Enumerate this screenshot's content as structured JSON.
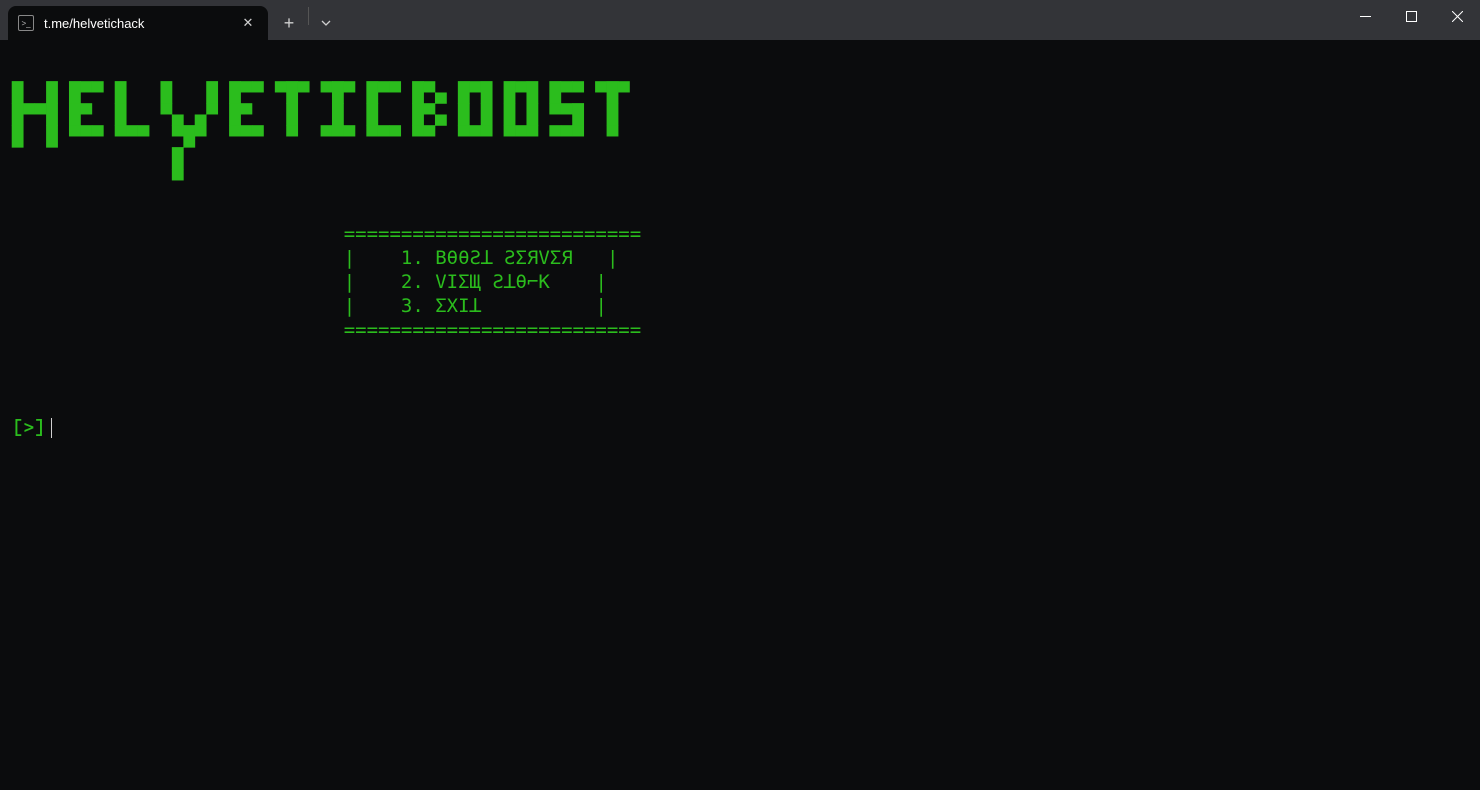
{
  "window": {
    "tab_title": "t.me/helvetichack"
  },
  "colors": {
    "terminal_bg": "#0b0c0d",
    "terminal_fg": "#2bbd1d",
    "titlebar_bg": "#333438"
  },
  "banner": {
    "text_plain": "HELVETICBOOST",
    "ascii": "█  █ █▀▀ █   █   █ █▀▀ ▀█▀ ▀█▀ █▀▀ █▀▄ █▀█ █▀█ █▀▀ ▀█▀\n█▀▀█ █▀  █   ▀▄ ▄▀ █▀   █   █  █   █▀▄ █ █ █ █ ▀▀█  █ \n█  █ ▀▀▀ ▀▀▀  ▀█▀  ▀▀▀  ▀  ▀▀▀ ▀▀▀ ▀▀  ▀▀▀ ▀▀▀ ▀▀▀  ▀ \n              █                                      \n              ▀                                      "
  },
  "menu": {
    "border_top": "                             ==========================",
    "row1": "                             |    1. BθθƧꓕ ƧΣЯVΣЯ   |",
    "row2": "                             |    2. VIΣЩ Ƨꓕθ⌐K    |",
    "row3": "                             |    3. ΣXIꓕ          |",
    "border_bottom": "                             ==========================",
    "items": [
      {
        "index": 1,
        "label_styled": "BθθƧꓕ ƧΣЯVΣЯ",
        "label_plain": "BOOST SERVER"
      },
      {
        "index": 2,
        "label_styled": "VIΣЩ Ƨꓕθ⌐K",
        "label_plain": "VIEW STOCK"
      },
      {
        "index": 3,
        "label_styled": "ΣXIꓕ",
        "label_plain": "EXIT"
      }
    ]
  },
  "prompt": {
    "symbol": "[>]",
    "input_value": ""
  }
}
